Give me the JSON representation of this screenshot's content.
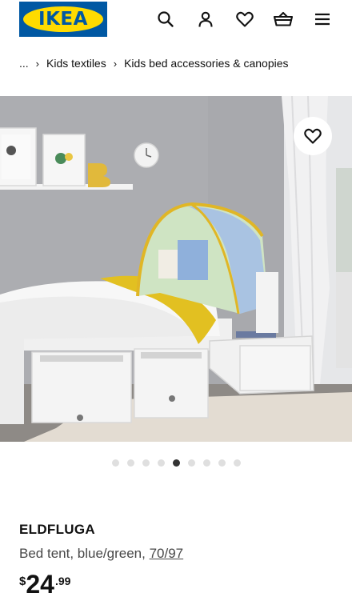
{
  "brand": {
    "logo_text": "IKEA",
    "colors": {
      "blue": "#0058a3",
      "yellow": "#ffdb00"
    }
  },
  "header": {
    "icons": [
      "search-icon",
      "profile-icon",
      "heart-icon",
      "basket-icon",
      "menu-icon"
    ]
  },
  "breadcrumb": {
    "ellipsis": "...",
    "items": [
      {
        "label": "Kids textiles"
      },
      {
        "label": "Kids bed accessories & canopies"
      }
    ]
  },
  "gallery": {
    "image_count": 9,
    "active_index": 4,
    "favorite_icon": "heart-icon"
  },
  "product": {
    "name": "ELDFLUGA",
    "description": "Bed tent, blue/green,",
    "size": "70/97",
    "price": {
      "currency": "$",
      "integer": "24",
      "decimal": ".99"
    }
  }
}
